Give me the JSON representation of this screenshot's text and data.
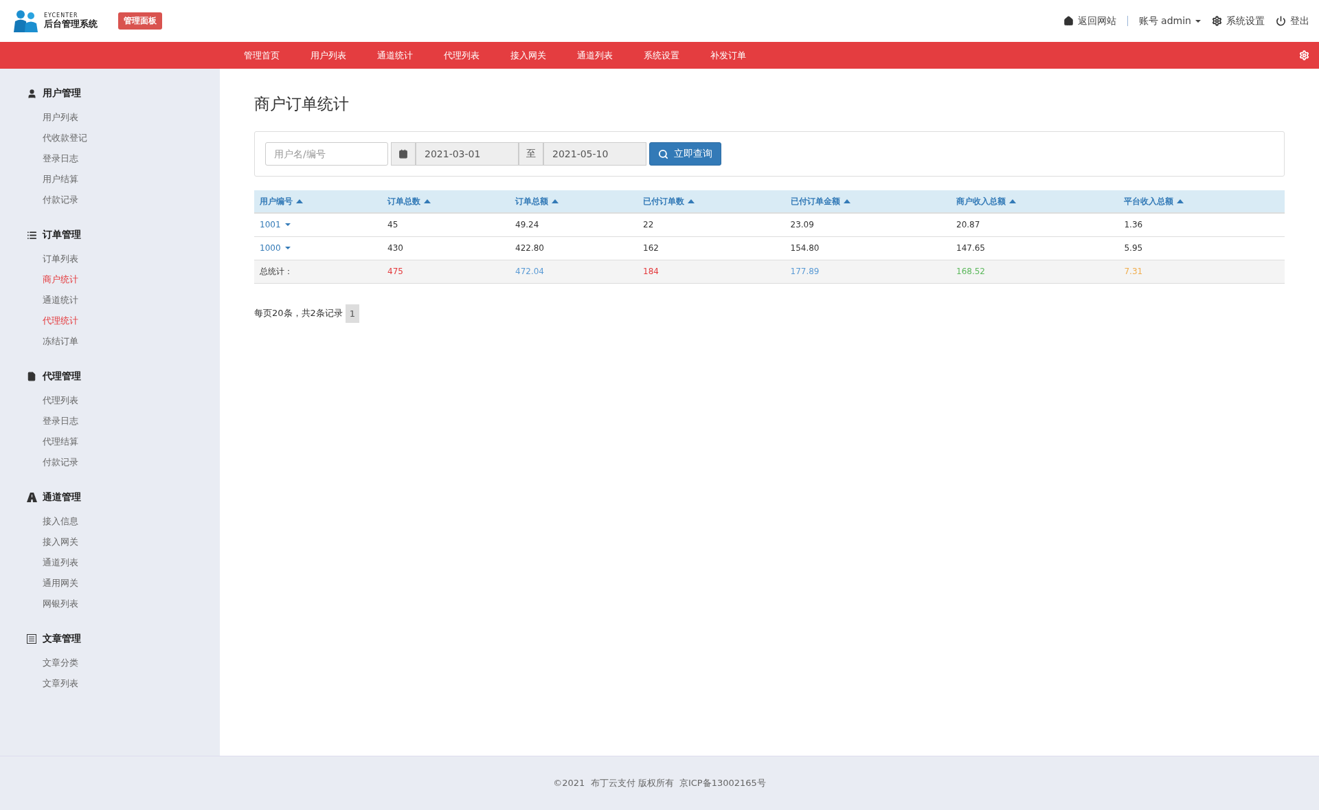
{
  "header": {
    "logo_caption": "EYCENTER",
    "logo_title": "后台管理系统",
    "badge": "管理面板",
    "links": [
      {
        "kind": "home",
        "label": "返回网站"
      },
      {
        "kind": "account",
        "label": "账号 admin"
      },
      {
        "kind": "settings",
        "label": "系统设置"
      },
      {
        "kind": "logout",
        "label": "登出"
      }
    ]
  },
  "nav": {
    "items": [
      {
        "label": "管理首页"
      },
      {
        "label": "用户列表"
      },
      {
        "label": "通道统计"
      },
      {
        "label": "代理列表"
      },
      {
        "label": "接入网关"
      },
      {
        "label": "通道列表"
      },
      {
        "label": "系统设置"
      },
      {
        "label": "补发订单"
      }
    ]
  },
  "sidebar": {
    "groups": [
      {
        "kind": "user",
        "title": "用户管理",
        "items": [
          {
            "label": "用户列表",
            "selected": false
          },
          {
            "label": "代收款登记",
            "selected": false
          },
          {
            "label": "登录日志",
            "selected": false
          },
          {
            "label": "用户结算",
            "selected": false
          },
          {
            "label": "付款记录",
            "selected": false
          }
        ]
      },
      {
        "kind": "list",
        "title": "订单管理",
        "items": [
          {
            "label": "订单列表",
            "selected": false
          },
          {
            "label": "商户统计",
            "selected": true
          },
          {
            "label": "通道统计",
            "selected": false
          },
          {
            "label": "代理统计",
            "selected": true
          },
          {
            "label": "冻结订单",
            "selected": false
          }
        ]
      },
      {
        "kind": "file",
        "title": "代理管理",
        "items": [
          {
            "label": "代理列表",
            "selected": false
          },
          {
            "label": "登录日志",
            "selected": false
          },
          {
            "label": "代理结算",
            "selected": false
          },
          {
            "label": "付款记录",
            "selected": false
          }
        ]
      },
      {
        "kind": "road",
        "title": "通道管理",
        "items": [
          {
            "label": "接入信息",
            "selected": false
          },
          {
            "label": "接入网关",
            "selected": false
          },
          {
            "label": "通道列表",
            "selected": false
          },
          {
            "label": "通用网关",
            "selected": false
          },
          {
            "label": "网银列表",
            "selected": false
          }
        ]
      },
      {
        "kind": "article",
        "title": "文章管理",
        "items": [
          {
            "label": "文章分类",
            "selected": false
          },
          {
            "label": "文章列表",
            "selected": false
          }
        ]
      }
    ]
  },
  "page_title": "商户订单统计",
  "filter": {
    "user_placeholder": "用户名/编号",
    "start_date": "2021-03-01",
    "separator": "至",
    "end_date": "2021-05-10",
    "button": "立即查询"
  },
  "table": {
    "columns": [
      "用户编号",
      "订单总数",
      "订单总额",
      "已付订单数",
      "已付订单金额",
      "商户收入总额",
      "平台收入总额"
    ],
    "rows": [
      {
        "cells": [
          "1001",
          "45",
          "49.24",
          "22",
          "23.09",
          "20.87",
          "1.36"
        ]
      },
      {
        "cells": [
          "1000",
          "430",
          "422.80",
          "162",
          "154.80",
          "147.65",
          "5.95"
        ]
      }
    ],
    "total": {
      "label": "总统计：",
      "cells": [
        {
          "value": "475",
          "color": "#e4393c"
        },
        {
          "value": "472.04",
          "color": "#5b9bd5"
        },
        {
          "value": "184",
          "color": "#e4393c"
        },
        {
          "value": "177.89",
          "color": "#5b9bd5"
        },
        {
          "value": "168.52",
          "color": "#5cb85c"
        },
        {
          "value": "7.31",
          "color": "#f0ad4e"
        }
      ]
    }
  },
  "pagination": {
    "summary": "每页20条，共2条记录",
    "pages": [
      {
        "label": "1",
        "selected": true
      }
    ]
  },
  "footer": "©2021  布丁云支付 版权所有  京ICP备13002165号"
}
